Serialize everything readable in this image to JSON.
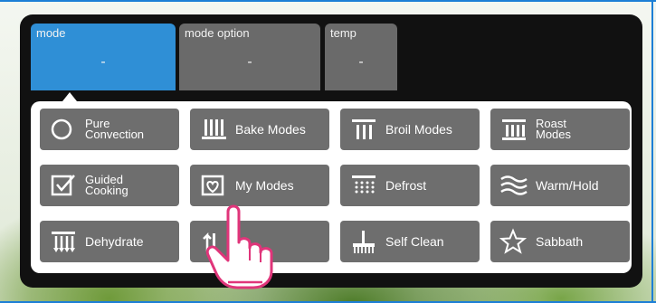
{
  "tabs": [
    {
      "title": "mode",
      "value": "-",
      "active": true
    },
    {
      "title": "mode option",
      "value": "-",
      "active": false
    },
    {
      "title": "temp",
      "value": "-",
      "active": false
    }
  ],
  "modes": [
    {
      "label": "Pure\nConvection",
      "icon": "circle-icon"
    },
    {
      "label": "Bake Modes",
      "icon": "bake-icon"
    },
    {
      "label": "Broil Modes",
      "icon": "broil-icon"
    },
    {
      "label": "Roast\nModes",
      "icon": "roast-icon"
    },
    {
      "label": "Guided\nCooking",
      "icon": "checkbox-icon"
    },
    {
      "label": "My Modes",
      "icon": "heart-box-icon"
    },
    {
      "label": "Defrost",
      "icon": "defrost-icon"
    },
    {
      "label": "Warm/Hold",
      "icon": "waves-icon"
    },
    {
      "label": "Dehydrate",
      "icon": "dehydrate-icon"
    },
    {
      "label": "",
      "icon": "upload-icon"
    },
    {
      "label": "Self Clean",
      "icon": "brush-icon"
    },
    {
      "label": "Sabbath",
      "icon": "star-icon"
    }
  ],
  "colors": {
    "active_tab": "#2f8fd6",
    "inactive_tab": "#6a6a6a",
    "button": "#6e6e6e",
    "hand_outline": "#e0357a"
  }
}
